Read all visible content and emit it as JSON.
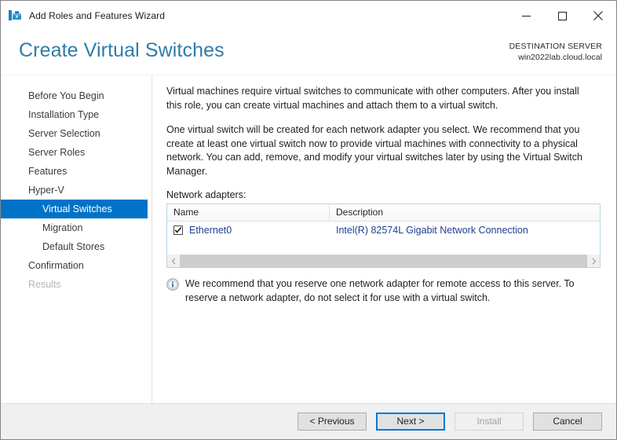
{
  "window": {
    "title": "Add Roles and Features Wizard",
    "icon": "wizard-toolbox-icon",
    "controls": {
      "minimize": "minimize-icon",
      "maximize": "maximize-icon",
      "close": "close-icon"
    }
  },
  "header": {
    "page_title": "Create Virtual Switches",
    "destination_label": "DESTINATION SERVER",
    "destination_server": "win2022lab.cloud.local",
    "title_color": "#2e7cac"
  },
  "sidebar": {
    "items": [
      {
        "label": "Before You Begin",
        "state": "normal",
        "indent": false
      },
      {
        "label": "Installation Type",
        "state": "normal",
        "indent": false
      },
      {
        "label": "Server Selection",
        "state": "normal",
        "indent": false
      },
      {
        "label": "Server Roles",
        "state": "normal",
        "indent": false
      },
      {
        "label": "Features",
        "state": "normal",
        "indent": false
      },
      {
        "label": "Hyper-V",
        "state": "normal",
        "indent": false
      },
      {
        "label": "Virtual Switches",
        "state": "selected",
        "indent": true
      },
      {
        "label": "Migration",
        "state": "normal",
        "indent": true
      },
      {
        "label": "Default Stores",
        "state": "normal",
        "indent": true
      },
      {
        "label": "Confirmation",
        "state": "normal",
        "indent": false
      },
      {
        "label": "Results",
        "state": "disabled",
        "indent": false
      }
    ],
    "selected_color": "#0073c8"
  },
  "main": {
    "paragraph1": "Virtual machines require virtual switches to communicate with other computers. After you install this role, you can create virtual machines and attach them to a virtual switch.",
    "paragraph2": "One virtual switch will be created for each network adapter you select. We recommend that you create at least one virtual switch now to provide virtual machines with connectivity to a physical network. You can add, remove, and modify your virtual switches later by using the Virtual Switch Manager.",
    "adapters_label": "Network adapters:",
    "table": {
      "columns": [
        "Name",
        "Description"
      ],
      "rows": [
        {
          "checked": true,
          "name": "Ethernet0",
          "description": "Intel(R) 82574L Gigabit Network Connection"
        }
      ],
      "row_text_color": "#21408f"
    },
    "scrollbar": {
      "left_arrow": "chevron-left-icon",
      "right_arrow": "chevron-right-icon"
    },
    "note": {
      "icon": "info-icon",
      "text": "We recommend that you reserve one network adapter for remote access to this server. To reserve a network adapter, do not select it for use with a virtual switch."
    }
  },
  "footer": {
    "previous_label": "< Previous",
    "next_label": "Next >",
    "install_label": "Install",
    "cancel_label": "Cancel",
    "next_focused": true,
    "install_disabled": true,
    "focus_color": "#0078d7"
  }
}
